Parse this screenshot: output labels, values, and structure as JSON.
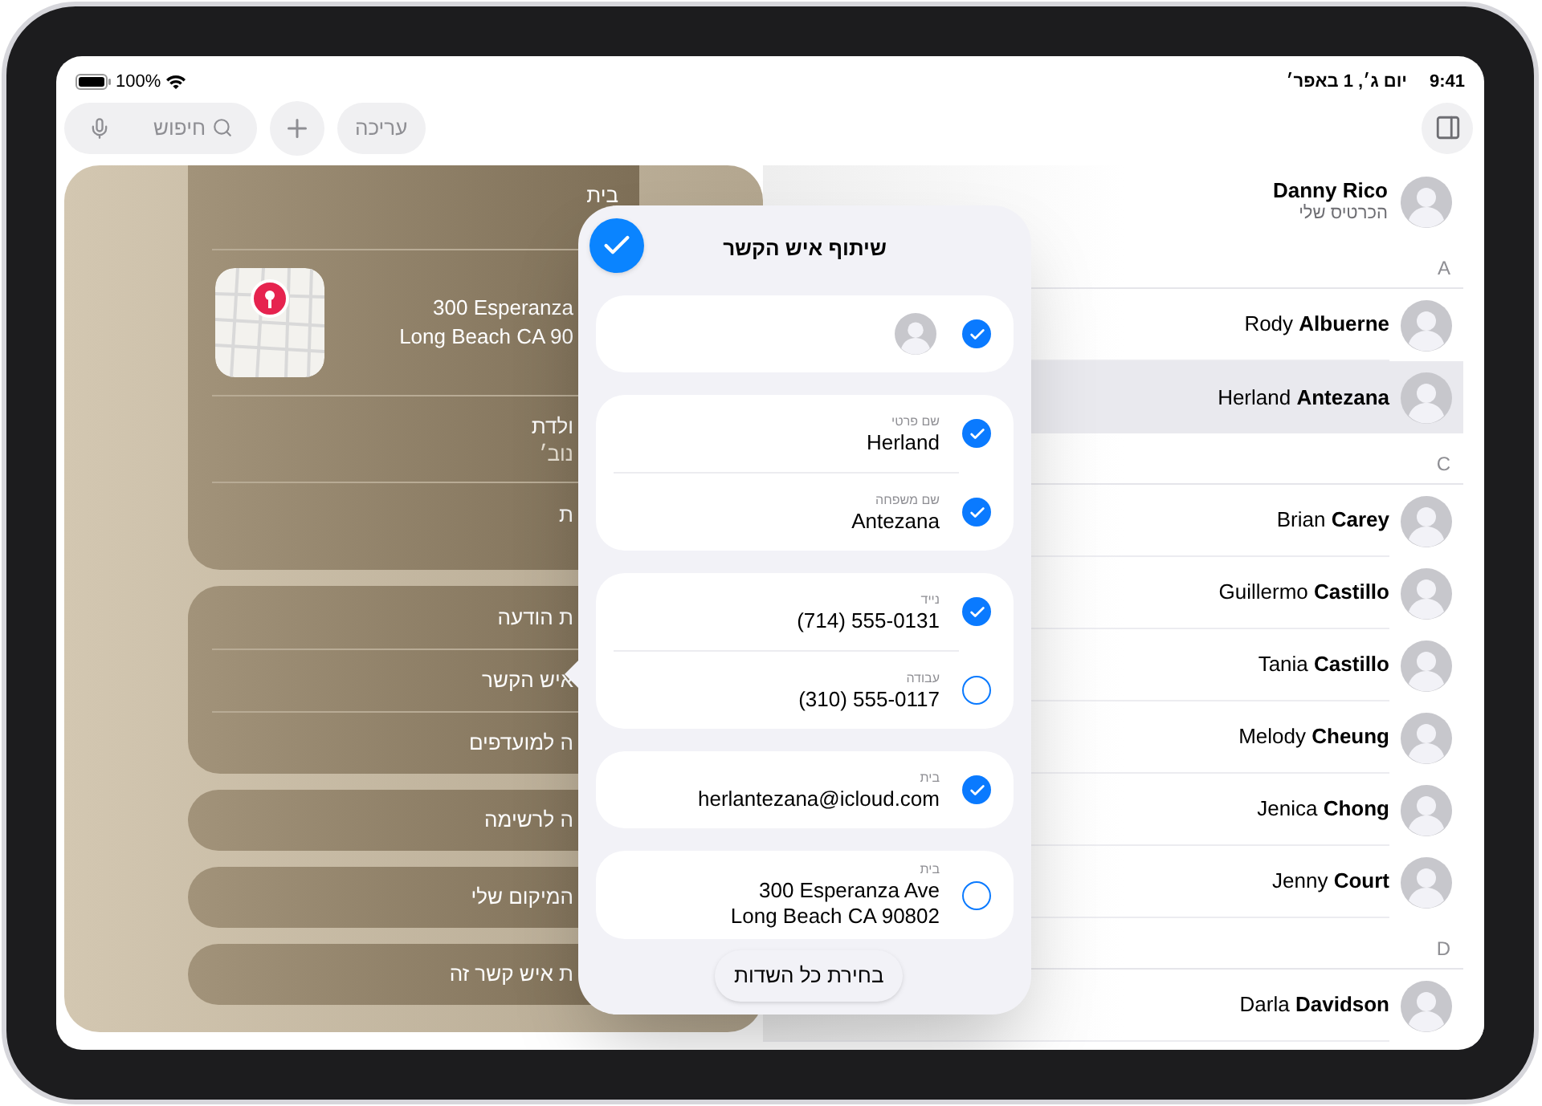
{
  "status_bar": {
    "battery": "100%",
    "date": "יום ג׳, 1 באפר׳",
    "time": "9:41"
  },
  "toolbar": {
    "search": {
      "placeholder": "חיפוש"
    },
    "edit_button": "עריכה"
  },
  "contact_card": {
    "header": "בית",
    "address_lines": [
      "300 Esperanza",
      "Long Beach CA 90"
    ],
    "birthday": {
      "label": "ולדת",
      "value": "נוב׳"
    },
    "row_4": "ת",
    "action_group": [
      "ת הודעה",
      "איש הקשר",
      "ה למועדפים"
    ],
    "actions": [
      "ה לרשימה",
      "המיקום שלי",
      "ת איש קשר זה"
    ]
  },
  "share_popover": {
    "title": "שיתוף איש הקשר",
    "groups": [
      {
        "fields": [
          {
            "kind": "photo",
            "checked": true
          }
        ]
      },
      {
        "fields": [
          {
            "kind": "text",
            "label": "שם פרטי",
            "value": "Herland",
            "checked": true
          },
          {
            "kind": "text",
            "label": "שם משפחה",
            "value": "Antezana",
            "checked": true
          }
        ]
      },
      {
        "fields": [
          {
            "kind": "text",
            "label": "נייד",
            "value": "(714) 555-0131",
            "checked": true
          },
          {
            "kind": "text",
            "label": "עבודה",
            "value": "(310) 555-0117",
            "checked": false
          }
        ]
      },
      {
        "fields": [
          {
            "kind": "text",
            "label": "בית",
            "value": "herlantezana@icloud.com",
            "checked": true
          }
        ]
      },
      {
        "fields": [
          {
            "kind": "text",
            "label": "בית",
            "value_lines": [
              "300 Esperanza Ave",
              "Long Beach CA 90802"
            ],
            "checked": false
          }
        ]
      }
    ],
    "select_all_button": "בחירת כל השדות"
  },
  "contacts": {
    "items": [
      {
        "kind": "me",
        "name": "Danny Rico",
        "subtitle": "הכרטיס שלי",
        "selected": false
      },
      {
        "kind": "section",
        "label": "A"
      },
      {
        "kind": "contact",
        "name": "Rody **Albuerne**",
        "selected": false
      },
      {
        "kind": "contact",
        "name": "Herland **Antezana**",
        "selected": true
      },
      {
        "kind": "section",
        "label": "C"
      },
      {
        "kind": "contact",
        "name": "Brian **Carey**",
        "selected": false
      },
      {
        "kind": "contact",
        "name": "Guillermo **Castillo**",
        "selected": false
      },
      {
        "kind": "contact",
        "name": "Tania **Castillo**",
        "selected": false
      },
      {
        "kind": "contact",
        "name": "Melody **Cheung**",
        "selected": false
      },
      {
        "kind": "contact",
        "name": "Jenica **Chong**",
        "selected": false
      },
      {
        "kind": "contact",
        "name": "Jenny **Court**",
        "selected": false
      },
      {
        "kind": "section",
        "label": "D"
      },
      {
        "kind": "contact",
        "name": "Darla **Davidson**",
        "selected": false
      }
    ]
  }
}
